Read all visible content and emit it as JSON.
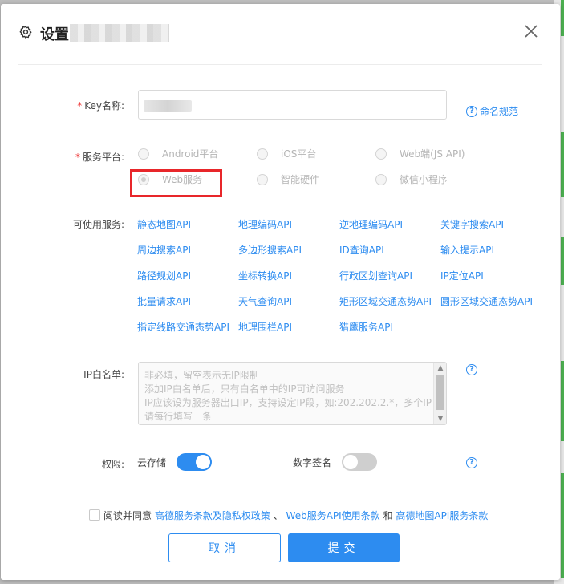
{
  "dialog": {
    "title": "设置",
    "close_icon": "close-icon",
    "settings_icon": "gear-icon"
  },
  "form": {
    "key_name_label": "Key名称:",
    "naming_rule_link": "命名规范",
    "service_platform_label": "服务平台:",
    "platform_options": [
      {
        "label": "Android平台",
        "selected": false
      },
      {
        "label": "iOS平台",
        "selected": false
      },
      {
        "label": "Web端(JS API)",
        "selected": false
      },
      {
        "label": "Web服务",
        "selected": true
      },
      {
        "label": "智能硬件",
        "selected": false
      },
      {
        "label": "微信小程序",
        "selected": false
      }
    ],
    "available_services_label": "可使用服务:",
    "apis": [
      "静态地图API",
      "地理编码API",
      "逆地理编码API",
      "关键字搜索API",
      "周边搜索API",
      "多边形搜索API",
      "ID查询API",
      "输入提示API",
      "路径规划API",
      "坐标转换API",
      "行政区划查询API",
      "IP定位API",
      "批量请求API",
      "天气查询API",
      "矩形区域交通态势API",
      "圆形区域交通态势API",
      "指定线路交通态势API",
      "地理围栏API",
      "猎鹰服务API"
    ],
    "ip_whitelist_label": "IP白名单:",
    "ip_whitelist_placeholder": [
      "非必填，留空表示无IP限制",
      "添加IP白名单后，只有白名单中的IP可访问服务",
      "IP应该设为服务器出口IP，支持设定IP段，如:202.202.2.*，多个IP",
      "请每行填写一条"
    ],
    "permissions_label": "权限:",
    "cloud_storage_label": "云存储",
    "cloud_storage_on": true,
    "digital_signature_label": "数字签名",
    "digital_signature_on": false
  },
  "agreement": {
    "prefix": "阅读并同意",
    "link1": "高德服务条款及隐私权政策",
    "sep1": "、",
    "link2": "Web服务API使用条款",
    "sep2": "和",
    "link3": "高德地图API服务条款",
    "checked": false
  },
  "buttons": {
    "cancel": "取消",
    "submit": "提交"
  },
  "colors": {
    "accent": "#2d8cf0",
    "required": "#e33333",
    "highlight": "#e8262a"
  }
}
